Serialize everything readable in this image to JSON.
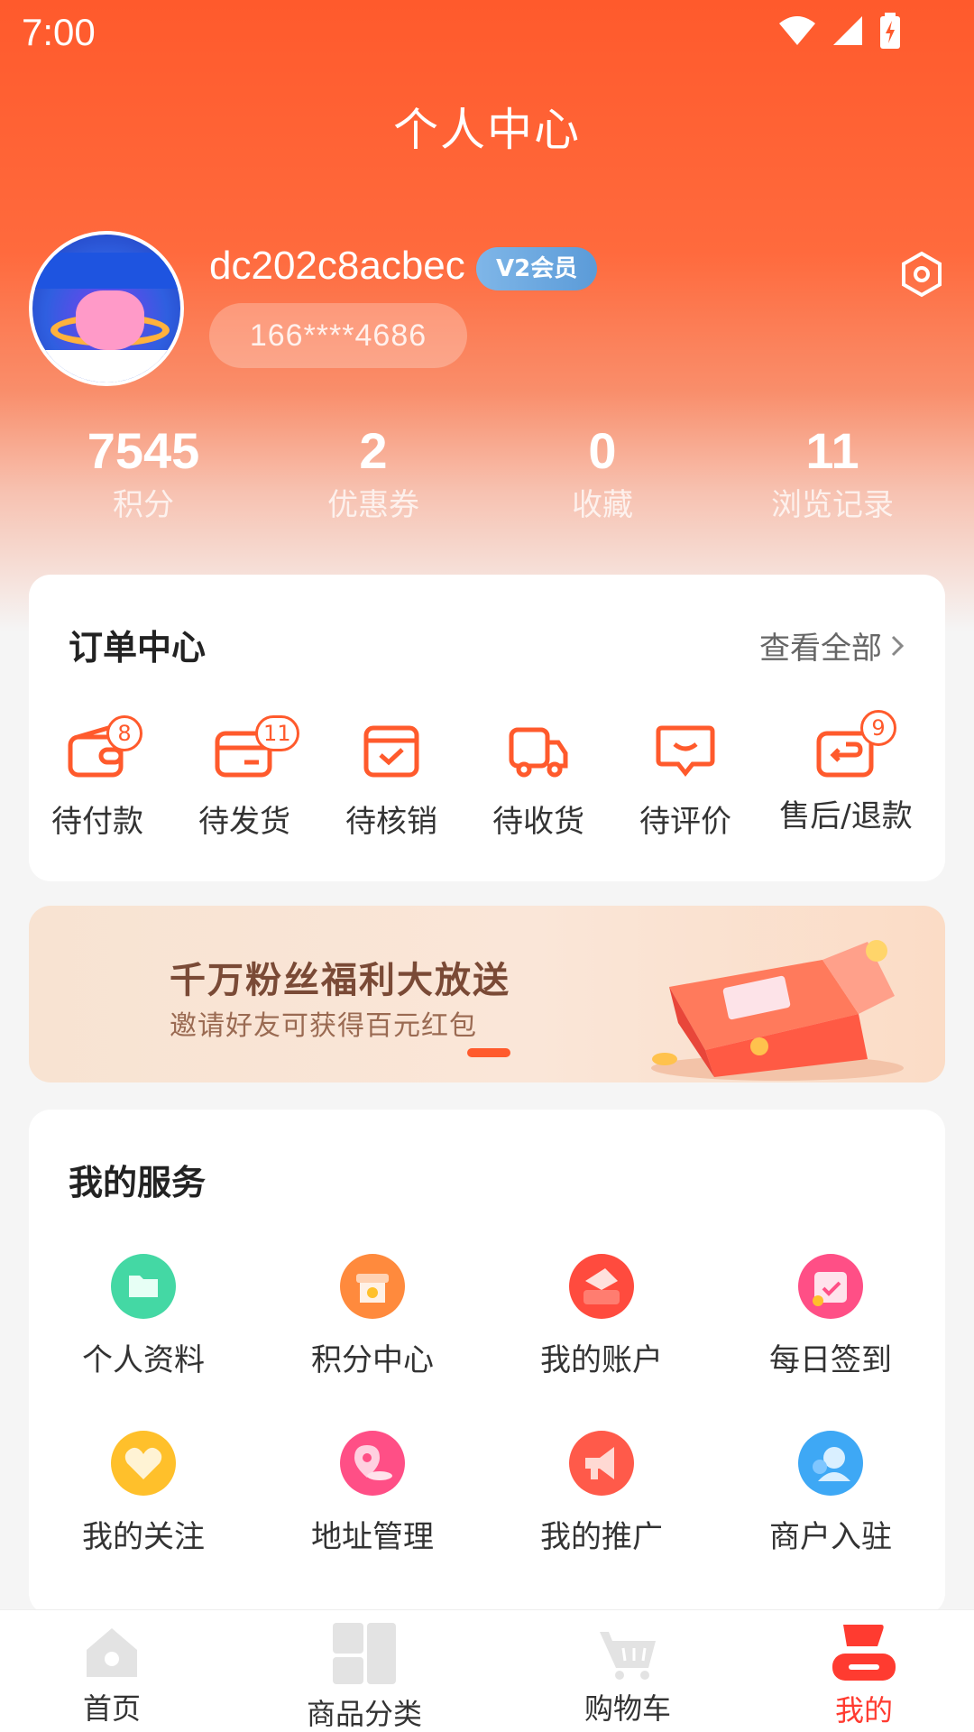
{
  "status": {
    "time": "7:00"
  },
  "header": {
    "title": "个人中心"
  },
  "profile": {
    "username": "dc202c8acbec",
    "vip": "V2会员",
    "phone": "166****4686"
  },
  "stats": [
    {
      "value": "7545",
      "label": "积分"
    },
    {
      "value": "2",
      "label": "优惠券"
    },
    {
      "value": "0",
      "label": "收藏"
    },
    {
      "value": "11",
      "label": "浏览记录"
    }
  ],
  "orders": {
    "title": "订单中心",
    "view_all": "查看全部",
    "items": [
      {
        "label": "待付款",
        "badge": "8",
        "icon": "wallet-icon"
      },
      {
        "label": "待发货",
        "badge": "11",
        "icon": "card-icon"
      },
      {
        "label": "待核销",
        "badge": "",
        "icon": "box-check-icon"
      },
      {
        "label": "待收货",
        "badge": "",
        "icon": "truck-icon"
      },
      {
        "label": "待评价",
        "badge": "",
        "icon": "comment-icon"
      },
      {
        "label": "售后/退款",
        "badge": "9",
        "icon": "return-icon"
      }
    ]
  },
  "banner": {
    "title": "千万粉丝福利大放送",
    "subtitle": "邀请好友可获得百元红包"
  },
  "services": {
    "title": "我的服务",
    "items": [
      {
        "label": "个人资料",
        "icon": "folder-icon",
        "color": "#3dd3a0"
      },
      {
        "label": "积分中心",
        "icon": "store-icon",
        "color": "#ff8a3d"
      },
      {
        "label": "我的账户",
        "icon": "account-icon",
        "color": "#ff4b3e"
      },
      {
        "label": "每日签到",
        "icon": "calendar-icon",
        "color": "#ff4f86"
      },
      {
        "label": "我的关注",
        "icon": "heart-icon",
        "color": "#ffc02b"
      },
      {
        "label": "地址管理",
        "icon": "location-icon",
        "color": "#ff4f86"
      },
      {
        "label": "我的推广",
        "icon": "megaphone-icon",
        "color": "#ff5a4a"
      },
      {
        "label": "商户入驻",
        "icon": "merchant-icon",
        "color": "#3ea8f5"
      }
    ]
  },
  "tabs": [
    {
      "label": "首页",
      "icon": "home-icon"
    },
    {
      "label": "商品分类",
      "icon": "category-icon"
    },
    {
      "label": "购物车",
      "icon": "cart-icon"
    },
    {
      "label": "我的",
      "icon": "profile-icon",
      "active": true
    }
  ],
  "colors": {
    "primary": "#ff5a2c",
    "active_tab": "#ff3b30"
  }
}
